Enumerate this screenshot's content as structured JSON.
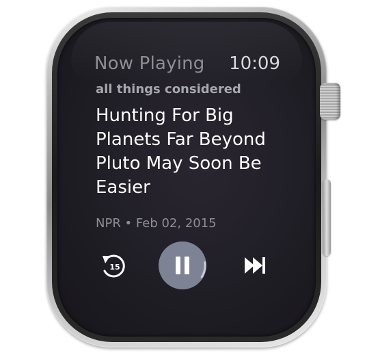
{
  "header": {
    "title": "Now Playing",
    "time": "10:09"
  },
  "track": {
    "program": "all things considered",
    "title": "Hunting For Big Planets Far Beyond Pluto May Soon Be Easier",
    "meta": "NPR • Feb 02, 2015"
  },
  "controls": {
    "skip_back_seconds": "15",
    "state": "playing",
    "progress": 0.12,
    "icons": {
      "skip_back": "skip-back-15-icon",
      "pause": "pause-icon",
      "next": "next-track-icon"
    }
  },
  "colors": {
    "accent_button": "#7d8295",
    "progress_arc": "#c9cbd6",
    "screen_background": "#211f27",
    "dim_text": "#8e8e93"
  }
}
